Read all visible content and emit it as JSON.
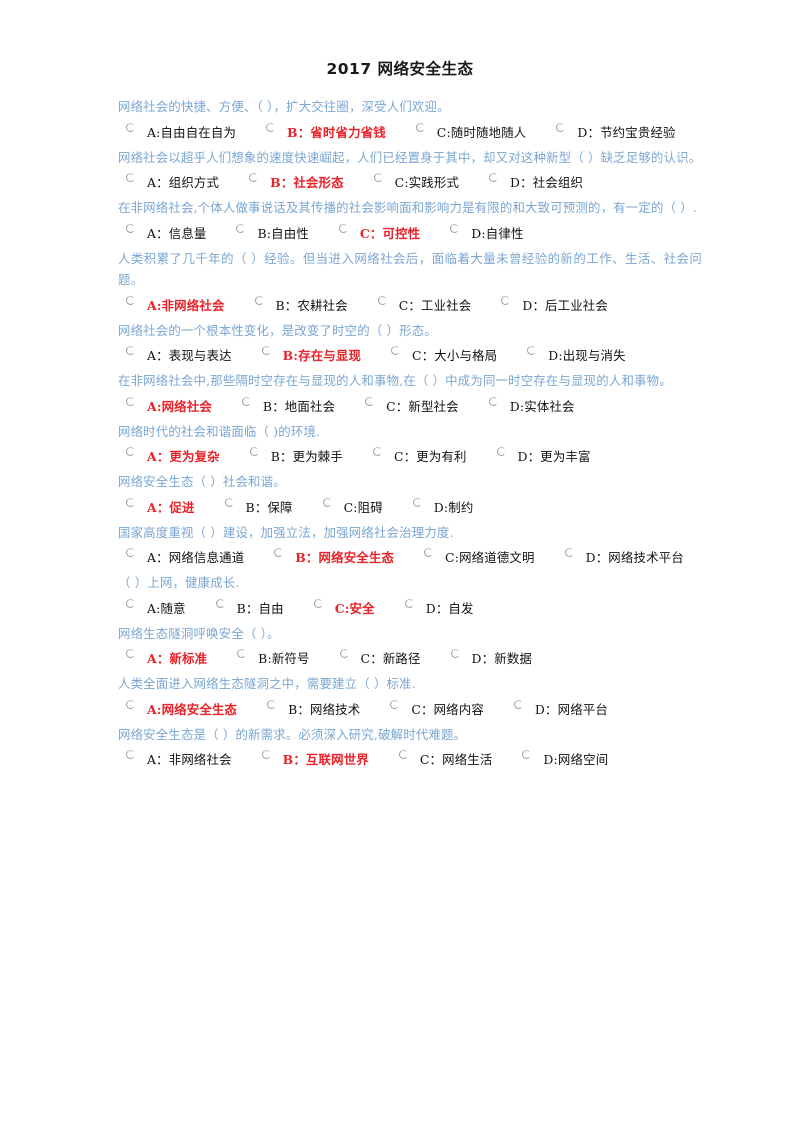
{
  "document": {
    "title": "2017 网络安全生态",
    "question_text_color": "#7aa6d2",
    "correct_answer_color": "#e8232a",
    "body_text_color": "#111111",
    "background_color": "#ffffff"
  },
  "radio": {
    "icon_name": "radio-unchecked-icon",
    "state": "unchecked"
  },
  "questions": [
    {
      "text": "网络社会的快捷、方便、（ ），扩大交往圈，深受人们欢迎。",
      "options": [
        {
          "label": "A:自由自在自为",
          "correct": false
        },
        {
          "label": "B：省时省力省钱",
          "correct": true
        },
        {
          "label": "C:随时随地随人",
          "correct": false
        },
        {
          "label": "D：节约宝贵经验",
          "correct": false
        }
      ]
    },
    {
      "text": "网络社会以超乎人们想象的速度快速崛起，人们已经置身于其中，却又对这种新型（ ）缺乏足够的认识。",
      "options": [
        {
          "label": "A：组织方式",
          "correct": false
        },
        {
          "label": "B：社会形态",
          "correct": true
        },
        {
          "label": "C:实践形式",
          "correct": false
        },
        {
          "label": "D：社会组织",
          "correct": false
        }
      ]
    },
    {
      "text": "在非网络社会,个体人做事说话及其传播的社会影响面和影响力是有限的和大致可预测的，有一定的（ ）.",
      "options": [
        {
          "label": "A：信息量",
          "correct": false
        },
        {
          "label": "B:自由性",
          "correct": false
        },
        {
          "label": "C：可控性",
          "correct": true
        },
        {
          "label": "D:自律性",
          "correct": false
        }
      ]
    },
    {
      "text": "人类积累了几千年的（ ）经验。但当进入网络社会后，面临着大量未曾经验的新的工作、生活、社会问题。",
      "options": [
        {
          "label": "A:非网络社会",
          "correct": true
        },
        {
          "label": "B：农耕社会",
          "correct": false
        },
        {
          "label": "C：工业社会",
          "correct": false
        },
        {
          "label": "D：后工业社会",
          "correct": false
        }
      ]
    },
    {
      "text": "网络社会的一个根本性变化，是改变了时空的（ ）形态。",
      "options": [
        {
          "label": "A：表现与表达",
          "correct": false
        },
        {
          "label": "B:存在与显现",
          "correct": true
        },
        {
          "label": "C：大小与格局",
          "correct": false
        },
        {
          "label": "D:出现与消失",
          "correct": false
        }
      ]
    },
    {
      "text": "在非网络社会中,那些隔时空存在与显现的人和事物,在（ ）中成为同一时空存在与显现的人和事物。",
      "options": [
        {
          "label": "A:网络社会",
          "correct": true
        },
        {
          "label": "B：地面社会",
          "correct": false
        },
        {
          "label": "C：新型社会",
          "correct": false
        },
        {
          "label": "D:实体社会",
          "correct": false
        }
      ]
    },
    {
      "text": "网络时代的社会和谐面临（ )的环境.",
      "options": [
        {
          "label": "A：更为复杂",
          "correct": true
        },
        {
          "label": "B：更为棘手",
          "correct": false
        },
        {
          "label": "C：更为有利",
          "correct": false
        },
        {
          "label": "D：更为丰富",
          "correct": false
        }
      ]
    },
    {
      "text": "网络安全生态（ ）社会和谐。",
      "options": [
        {
          "label": "A：促进",
          "correct": true
        },
        {
          "label": "B：保障",
          "correct": false
        },
        {
          "label": "C:阻碍",
          "correct": false
        },
        {
          "label": "D:制约",
          "correct": false
        }
      ]
    },
    {
      "text": "国家高度重视（ ）建设，加强立法，加强网络社会治理力度.",
      "options": [
        {
          "label": "A：网络信息通道",
          "correct": false
        },
        {
          "label": "B：网络安全生态",
          "correct": true
        },
        {
          "label": "C:网络道德文明",
          "correct": false
        },
        {
          "label": "D：网络技术平台",
          "correct": false
        }
      ]
    },
    {
      "text": "（ ）上网，健康成长.",
      "options": [
        {
          "label": "A:随意",
          "correct": false
        },
        {
          "label": "B：自由",
          "correct": false
        },
        {
          "label": "C:安全",
          "correct": true
        },
        {
          "label": "D：自发",
          "correct": false
        }
      ]
    },
    {
      "text": "网络生态隧洞呼唤安全（ ）。",
      "options": [
        {
          "label": "A：新标准",
          "correct": true
        },
        {
          "label": "B:新符号",
          "correct": false
        },
        {
          "label": "C：新路径",
          "correct": false
        },
        {
          "label": "D：新数据",
          "correct": false
        }
      ]
    },
    {
      "text": "人类全面进入网络生态隧洞之中，需要建立（ ）标准.",
      "options": [
        {
          "label": "A:网络安全生态",
          "correct": true
        },
        {
          "label": "B：网络技术",
          "correct": false
        },
        {
          "label": "C：网络内容",
          "correct": false
        },
        {
          "label": "D：网络平台",
          "correct": false
        }
      ]
    },
    {
      "text": "网络安全生态是（ ）的新需求。必须深入研究,破解时代难题。",
      "options": [
        {
          "label": "A：非网络社会",
          "correct": false
        },
        {
          "label": "B：互联网世界",
          "correct": true
        },
        {
          "label": "C：网络生活",
          "correct": false
        },
        {
          "label": "D:网络空间",
          "correct": false
        }
      ]
    }
  ]
}
